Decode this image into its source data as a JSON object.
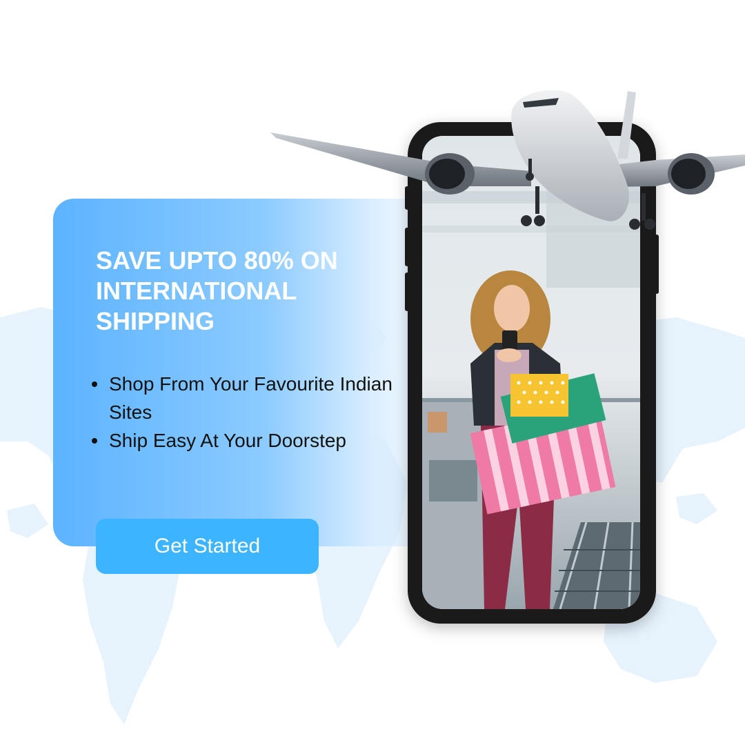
{
  "promo": {
    "headline": "SAVE UPTO 80% ON INTERNATIONAL SHIPPING",
    "bullets": [
      "Shop From Your Favourite Indian Sites",
      "Ship Easy At Your Doorstep"
    ],
    "cta_label": "Get Started"
  },
  "colors": {
    "panel_gradient_start": "#5cb3ff",
    "button": "#3db4ff",
    "headline_text": "#ffffff",
    "body_text": "#111111",
    "map": "#e6f2fc"
  },
  "images": {
    "map": "world-map-illustration",
    "phone": "smartphone-photo-woman-with-shopping-bags",
    "airplane": "airplane-illustration"
  }
}
